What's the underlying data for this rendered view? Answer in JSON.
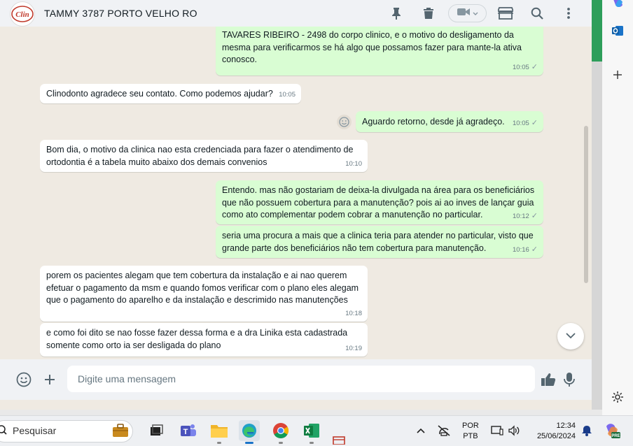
{
  "header": {
    "contact_name": "TAMMY 3787 PORTO VELHO RO",
    "avatar_text": "Clin"
  },
  "messages": [
    {
      "direction": "out",
      "lines": "TAVARES RIBEIRO - 2498 do corpo clinico, e o motivo do desligamento da mesma para verificarmos se há algo que possamos fazer para mante-la ativa conosco.",
      "time": "10:05",
      "check": "✓"
    },
    {
      "direction": "in",
      "lines": "Clinodonto agradece seu contato. Como podemos ajudar?",
      "time": "10:05"
    },
    {
      "direction": "out",
      "lines": "Aguardo retorno, desde já agradeço.",
      "time": "10:05",
      "check": "✓"
    },
    {
      "direction": "in",
      "lines": "Bom dia, o motivo da clinica nao esta credenciada para fazer o atendimento de ortodontia é a tabela muito abaixo dos demais convenios",
      "time": "10:10"
    },
    {
      "direction": "out",
      "lines": "Entendo. mas não gostariam de deixa-la divulgada na área para os beneficiários que não possuem cobertura para a manutenção? pois ai ao inves de lançar guia como ato complementar podem cobrar a manutenção no particular.",
      "time": "10:12",
      "check": "✓"
    },
    {
      "direction": "out",
      "lines": "seria uma procura a mais que a clinica teria para atender no particular, visto que grande parte dos beneficiários não tem cobertura para manutenção.",
      "time": "10:16",
      "check": "✓"
    },
    {
      "direction": "in",
      "lines": "porem os pacientes alegam que tem cobertura da instalação e ai nao querem efetuar o pagamento da msm e quando fomos verificar com o plano eles alegam que o pagamento do aparelho e da instalação e descrimido nas manutenções",
      "time": "10:18"
    },
    {
      "direction": "in",
      "lines": "e como foi dito se nao fosse fazer dessa forma e a dra Linika esta cadastrada somente como orto ia ser desligada do plano",
      "time": "10:19"
    }
  ],
  "composer": {
    "placeholder": "Digite uma mensagem"
  },
  "taskbar": {
    "search_label": "Pesquisar",
    "lang_top": "POR",
    "lang_bottom": "PTB",
    "time": "12:34",
    "date": "25/06/2024",
    "copilot_badge": "PRE"
  },
  "colors": {
    "incoming_bubble": "#ffffff",
    "outgoing_bubble": "#d9fdd3",
    "chat_background": "#efeae2",
    "accent_green": "#2e9e5a"
  },
  "icons": {
    "header": [
      "pin-icon",
      "trash-icon",
      "video-camera-icon",
      "shop-icon",
      "search-icon",
      "menu-dots-icon"
    ],
    "composer": [
      "emoji-icon",
      "plus-icon",
      "thumbs-up-icon",
      "microphone-icon"
    ],
    "side": [
      "copilot-icon",
      "outlook-icon",
      "add-icon",
      "settings-icon"
    ],
    "taskbar": [
      "briefcase-icon",
      "task-view-icon",
      "teams-icon",
      "file-explorer-icon",
      "edge-icon",
      "chrome-icon",
      "excel-icon"
    ]
  }
}
